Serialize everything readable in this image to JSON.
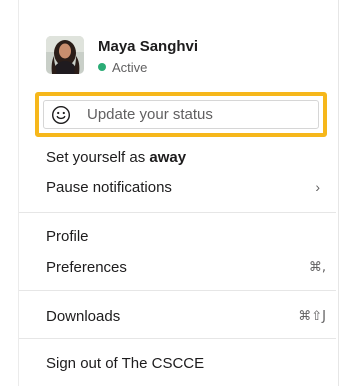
{
  "user": {
    "name": "Maya Sanghvi",
    "presence": "Active"
  },
  "status": {
    "placeholder": "Update your status"
  },
  "menu": {
    "set_away_prefix": "Set yourself as ",
    "set_away_bold": "away",
    "pause_notifications": "Pause notifications",
    "pause_chevron": "›",
    "profile": "Profile",
    "preferences": "Preferences",
    "preferences_shortcut": "⌘,",
    "downloads": "Downloads",
    "downloads_shortcut": "⌘⇧J",
    "sign_out": "Sign out of The CSCCE"
  },
  "colors": {
    "highlight": "#f6b71b",
    "presence_active": "#2bac76",
    "text_primary": "#1d1c1d",
    "text_secondary": "#616061"
  }
}
